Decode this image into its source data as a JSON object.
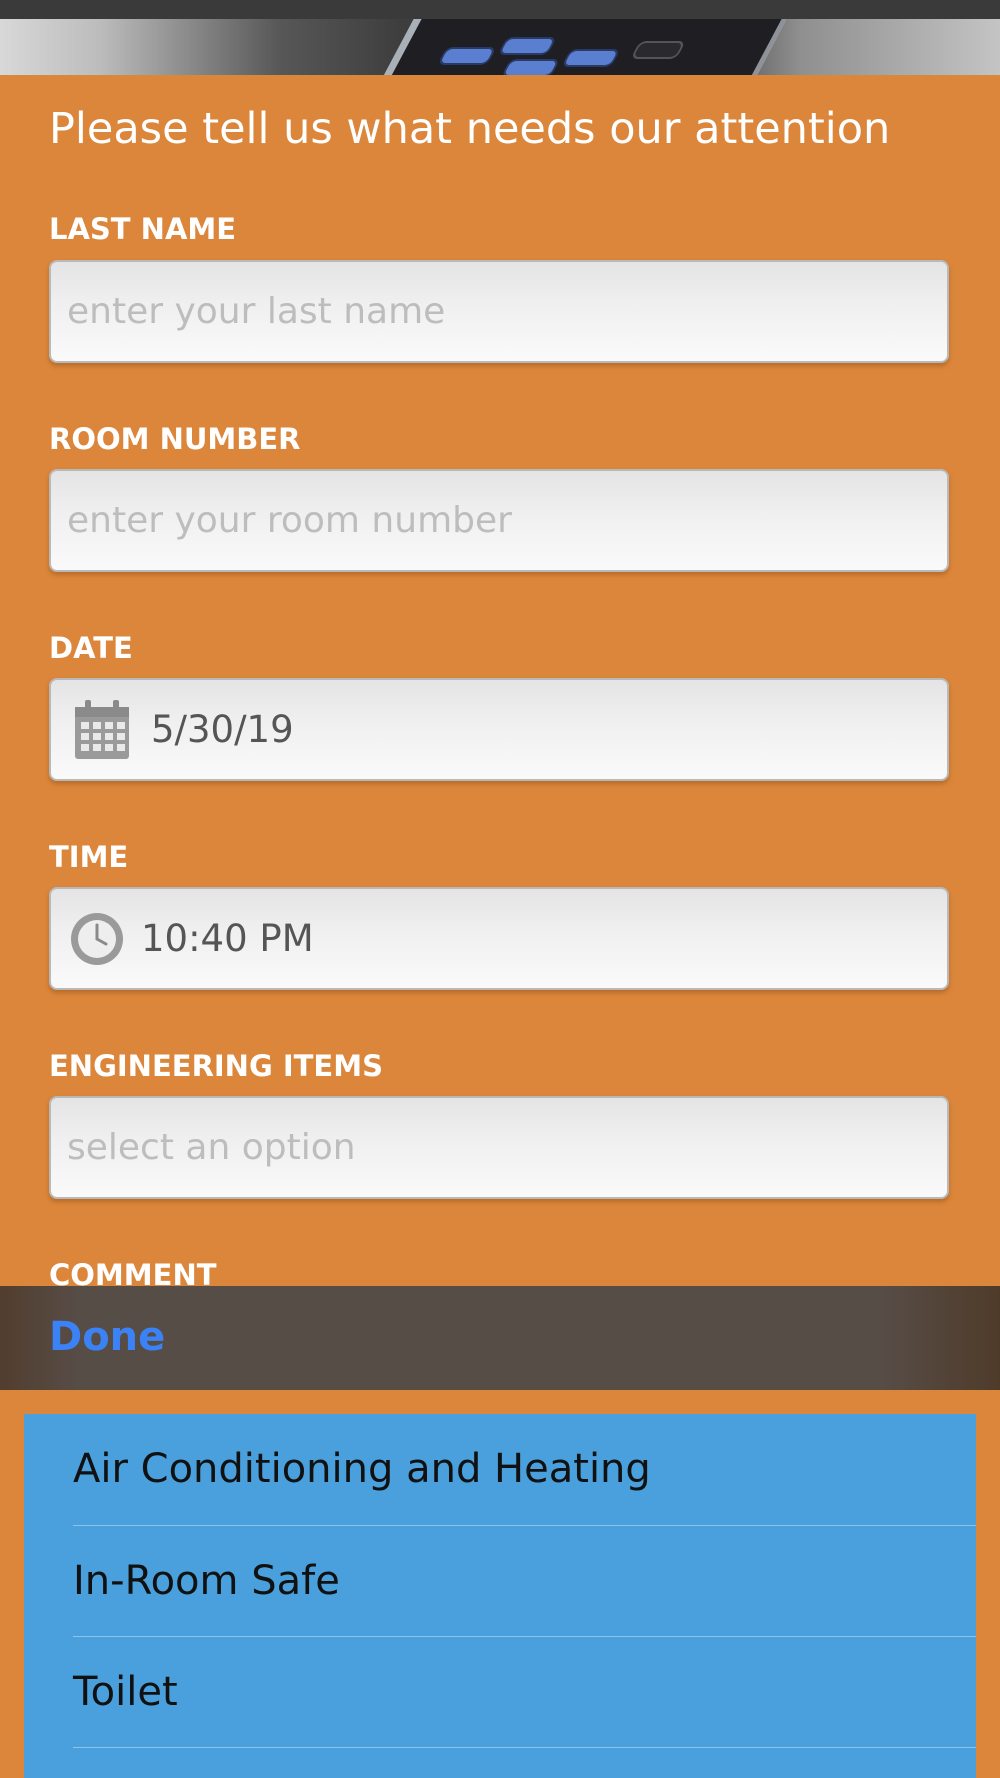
{
  "header": {
    "title": "Please tell us what needs our attention"
  },
  "form": {
    "last_name": {
      "label": "LAST NAME",
      "placeholder": "enter your last name"
    },
    "room_number": {
      "label": "ROOM NUMBER",
      "placeholder": "enter your room number"
    },
    "date": {
      "label": "DATE",
      "value": "5/30/19",
      "icon": "calendar-icon"
    },
    "time": {
      "label": "TIME",
      "value": "10:40 PM",
      "icon": "clock-icon"
    },
    "engineering_items": {
      "label": "ENGINEERING ITEMS",
      "placeholder": "select an option"
    },
    "comment": {
      "label": "COMMENT"
    }
  },
  "picker": {
    "done_label": "Done",
    "options": [
      {
        "label": "Air Conditioning and Heating"
      },
      {
        "label": "In-Room Safe"
      },
      {
        "label": "Toilet"
      }
    ]
  },
  "colors": {
    "background": "#DB863B",
    "picker_background": "#49A0DC",
    "done_color": "#3B82F6",
    "toolbar": "#574D47"
  }
}
